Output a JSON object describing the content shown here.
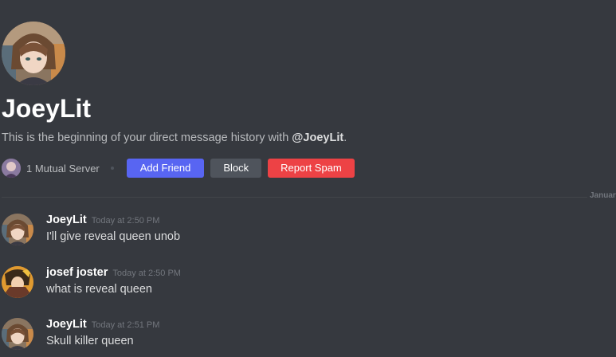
{
  "profile": {
    "username": "JoeyLit",
    "intro_prefix": "This is the beginning of your direct message history with ",
    "intro_mention": "@JoeyLit",
    "intro_suffix": "."
  },
  "actions": {
    "mutual_servers": "1 Mutual Server",
    "add_friend": "Add Friend",
    "block": "Block",
    "report_spam": "Report Spam"
  },
  "divider": {
    "date_label": "January"
  },
  "messages": [
    {
      "author": "JoeyLit",
      "time": "Today at 2:50 PM",
      "text": "I'll give reveal queen unob"
    },
    {
      "author": "josef joster",
      "time": "Today at 2:50 PM",
      "text": "what is reveal queen"
    },
    {
      "author": "JoeyLit",
      "time": "Today at 2:51 PM",
      "text": "Skull killer queen"
    }
  ],
  "colors": {
    "background": "#36393f",
    "add_friend": "#5865f2",
    "block": "#4f545c",
    "report_spam": "#ed4245"
  }
}
